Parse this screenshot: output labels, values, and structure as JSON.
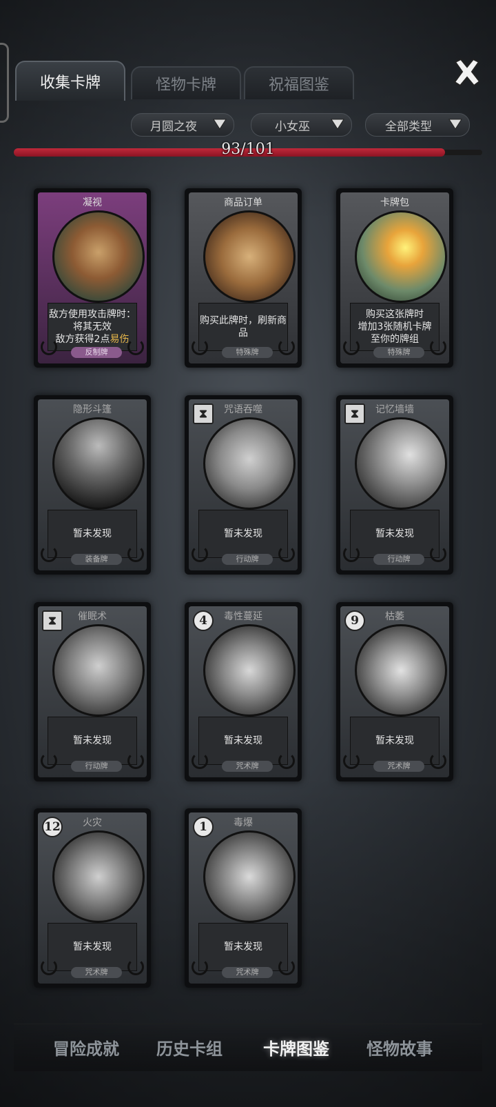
{
  "tabs": [
    {
      "label": "收集卡牌",
      "active": true
    },
    {
      "label": "怪物卡牌",
      "active": false
    },
    {
      "label": "祝福图鉴",
      "active": false
    }
  ],
  "close_icon": "close-x-icon",
  "filters": [
    {
      "label": "月圆之夜"
    },
    {
      "label": "小女巫"
    },
    {
      "label": "全部类型"
    }
  ],
  "progress": {
    "text": "93/101",
    "collected": 93,
    "total": 101
  },
  "cards": [
    {
      "title": "凝视",
      "desc": [
        "敌方使用攻击牌时：",
        "将其无效",
        "敌方获得2点"
      ],
      "highlight": "易伤",
      "type": "反制牌",
      "owned": true
    },
    {
      "title": "商品订单",
      "desc": [
        "购买此牌时，刷新商品"
      ],
      "type": "特殊牌",
      "owned": true
    },
    {
      "title": "卡牌包",
      "desc": [
        "购买这张牌时",
        "增加3张随机卡牌",
        "至你的牌组"
      ],
      "type": "特殊牌",
      "owned": true
    },
    {
      "title": "隐形斗篷",
      "desc": [
        "暂未发现"
      ],
      "type": "装备牌",
      "owned": false
    },
    {
      "title": "咒语吞噬",
      "desc": [
        "暂未发现"
      ],
      "type": "行动牌",
      "owned": false
    },
    {
      "title": "记忆墙墙",
      "desc": [
        "暂未发现"
      ],
      "type": "行动牌",
      "owned": false
    },
    {
      "title": "催眠术",
      "desc": [
        "暂未发现"
      ],
      "type": "行动牌",
      "owned": false
    },
    {
      "title": "毒性蔓延",
      "desc": [
        "暂未发现"
      ],
      "type": "咒术牌",
      "owned": false,
      "cost": "4"
    },
    {
      "title": "枯萎",
      "desc": [
        "暂未发现"
      ],
      "type": "咒术牌",
      "owned": false,
      "cost": "9"
    },
    {
      "title": "火灾",
      "desc": [
        "暂未发现"
      ],
      "type": "咒术牌",
      "owned": false,
      "cost": "12"
    },
    {
      "title": "毒爆",
      "desc": [
        "暂未发现"
      ],
      "type": "咒术牌",
      "owned": false,
      "cost": "1"
    }
  ],
  "bottom_nav": [
    {
      "label": "冒险成就",
      "active": false
    },
    {
      "label": "历史卡组",
      "active": false
    },
    {
      "label": "卡牌图鉴",
      "active": true
    },
    {
      "label": "怪物故事",
      "active": false
    }
  ],
  "colors": {
    "accent_red": "#b8202f",
    "purple_frame": "#7c3e7d",
    "highlight": "#e6b64a"
  }
}
